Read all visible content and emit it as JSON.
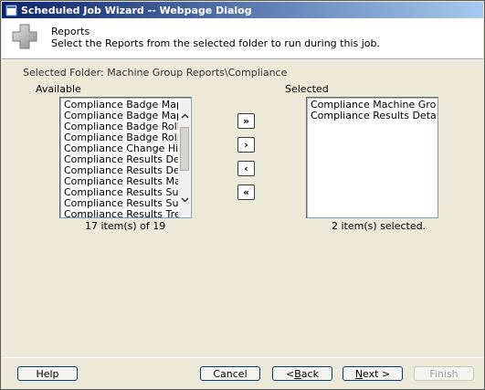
{
  "window": {
    "title": "Scheduled Job Wizard -- Webpage Dialog"
  },
  "header": {
    "title": "Reports",
    "description": "Select the Reports from the selected folder to run during this job.",
    "icon": "plus-cross-icon"
  },
  "folder": {
    "label": "Selected Folder:",
    "path": "Machine Group Reports\\Compliance"
  },
  "available": {
    "label": "Available",
    "items": [
      "Compliance Badge Mapping",
      "Compliance Badge Mapping",
      "Compliance Badge Rollup",
      "Compliance Badge Rollup",
      "Compliance Change History",
      "Compliance Results Detail",
      "Compliance Results Detail",
      "Compliance Results Machine",
      "Compliance Results Summary",
      "Compliance Results Summary",
      "Compliance Results Trend"
    ],
    "count_text": "17 item(s) of 19"
  },
  "selected": {
    "label": "Selected",
    "items": [
      "Compliance Machine Group Summary",
      "Compliance Results Detail by"
    ],
    "count_text": "2 item(s) selected."
  },
  "move_buttons": {
    "add_all": "»",
    "add": "›",
    "remove": "‹",
    "remove_all": "«"
  },
  "footer": {
    "help": "Help",
    "cancel": "Cancel",
    "back_prefix": "< ",
    "back_accel": "B",
    "back_rest": "ack",
    "next_accel": "N",
    "next_rest": "ext >",
    "finish": "Finish"
  }
}
